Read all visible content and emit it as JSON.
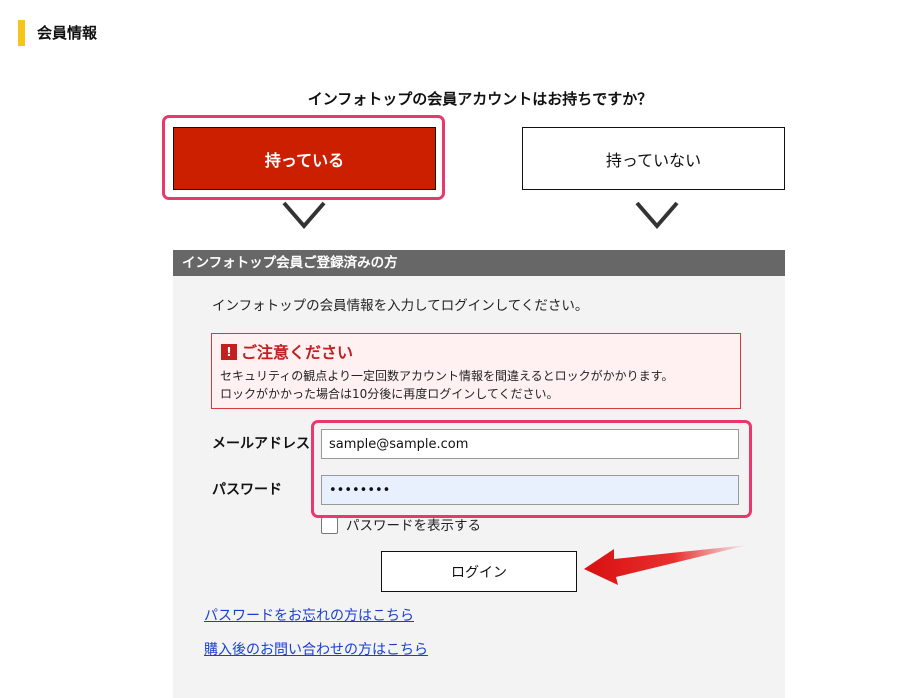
{
  "section": {
    "title": "会員情報"
  },
  "question": "インフォトップの会員アカウントはお持ちですか？",
  "choices": {
    "have": "持っている",
    "not_have": "持っていない"
  },
  "panel": {
    "header": "インフォトップ会員ご登録済みの方",
    "intro": "インフォトップの会員情報を入力してログインしてください。",
    "notice": {
      "icon": "!",
      "title": "ご注意ください",
      "line1": "セキュリティの観点より一定回数アカウント情報を間違えるとロックがかかります。",
      "line2": "ロックがかかった場合は10分後に再度ログインしてください。"
    },
    "email": {
      "label": "メールアドレス",
      "value": "sample@sample.com"
    },
    "password": {
      "label": "パスワード",
      "value": "••••••••"
    },
    "show_password": {
      "label": "パスワードを表示する",
      "checked": false
    },
    "login_button": "ログイン",
    "links": {
      "forgot": "パスワードをお忘れの方はこちら",
      "inquiry": "購入後のお問い合わせの方はこちら"
    }
  },
  "colors": {
    "accent_yellow": "#f5c518",
    "selected_red": "#cc1f00",
    "highlight_pink": "#e8386c",
    "notice_red": "#c21f1f",
    "link_blue": "#1a3ecf"
  },
  "icons": [
    "chevron-down-icon",
    "warning-icon",
    "red-arrow-icon"
  ]
}
